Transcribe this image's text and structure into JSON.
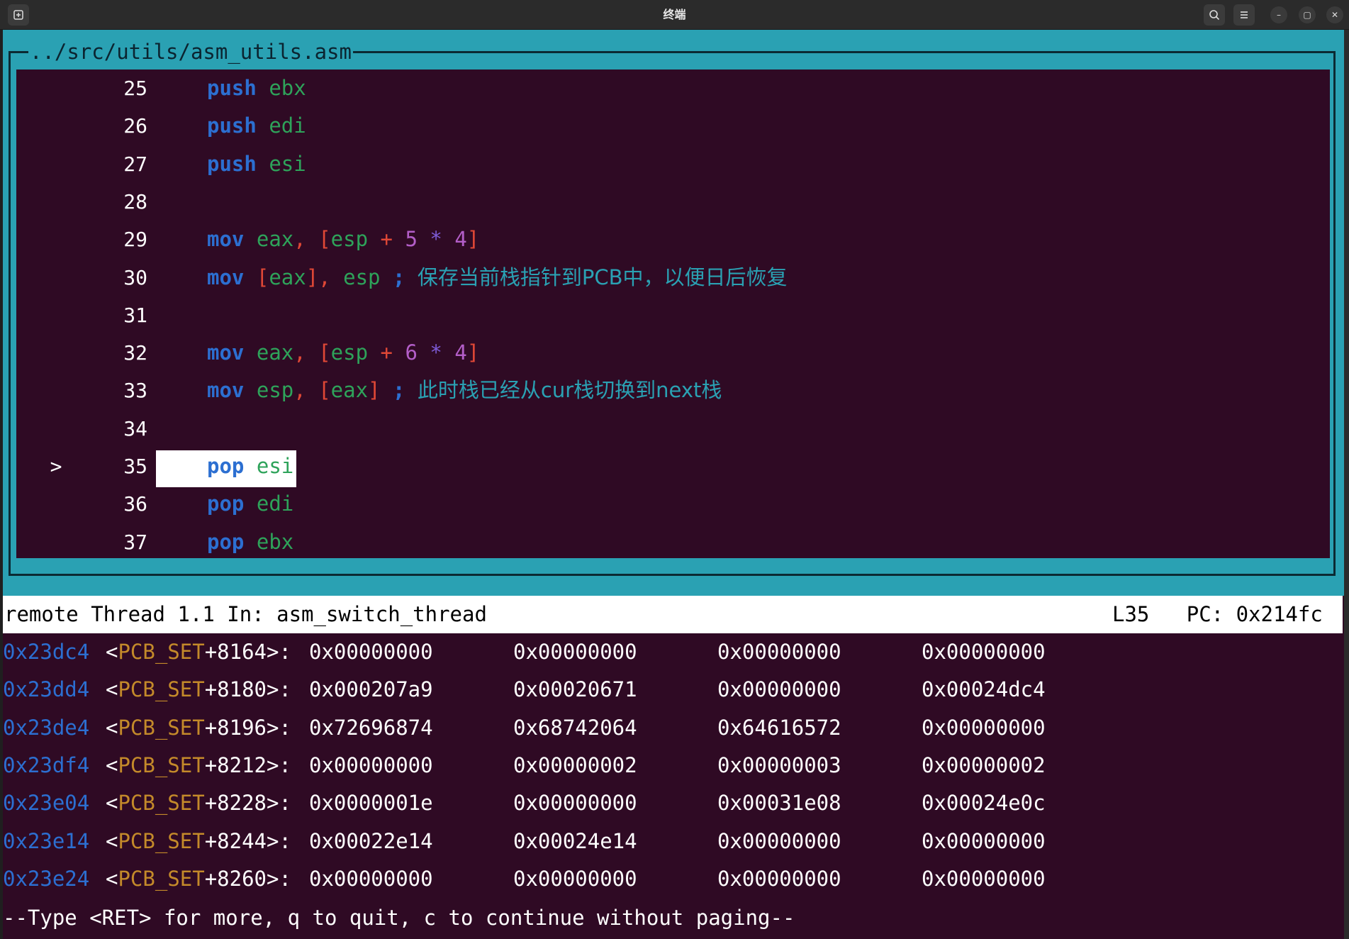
{
  "window": {
    "title": "终端",
    "left_icon": "new-tab-icon",
    "search_icon": "search-icon",
    "menu_icon": "hamburger-menu-icon",
    "minimize_glyph": "–",
    "maximize_glyph": "▢",
    "close_glyph": "✕",
    "colors": {
      "titlebar": "#2b2b2b",
      "terminal_bg": "#2f0a24",
      "tui_border": "#2aa1b3"
    }
  },
  "source": {
    "file_title": "../src/utils/asm_utils.asm",
    "current_marker": ">",
    "lines": [
      {
        "num": "25",
        "tokens": [
          {
            "t": "push",
            "c": "kw"
          },
          {
            "t": " "
          },
          {
            "t": "ebx",
            "c": "reg"
          }
        ]
      },
      {
        "num": "26",
        "tokens": [
          {
            "t": "push",
            "c": "kw"
          },
          {
            "t": " "
          },
          {
            "t": "edi",
            "c": "reg"
          }
        ]
      },
      {
        "num": "27",
        "tokens": [
          {
            "t": "push",
            "c": "kw"
          },
          {
            "t": " "
          },
          {
            "t": "esi",
            "c": "reg"
          }
        ]
      },
      {
        "num": "28",
        "tokens": []
      },
      {
        "num": "29",
        "tokens": [
          {
            "t": "mov",
            "c": "kw"
          },
          {
            "t": " "
          },
          {
            "t": "eax",
            "c": "reg"
          },
          {
            "t": ",",
            "c": "br"
          },
          {
            "t": " "
          },
          {
            "t": "[",
            "c": "br"
          },
          {
            "t": "esp",
            "c": "reg"
          },
          {
            "t": " "
          },
          {
            "t": "+",
            "c": "br"
          },
          {
            "t": " "
          },
          {
            "t": "5",
            "c": "num"
          },
          {
            "t": " "
          },
          {
            "t": "*",
            "c": "pl"
          },
          {
            "t": " "
          },
          {
            "t": "4",
            "c": "num"
          },
          {
            "t": "]",
            "c": "br"
          }
        ]
      },
      {
        "num": "30",
        "tokens": [
          {
            "t": "mov",
            "c": "kw"
          },
          {
            "t": " "
          },
          {
            "t": "[",
            "c": "br"
          },
          {
            "t": "eax",
            "c": "reg"
          },
          {
            "t": "],",
            "c": "br"
          },
          {
            "t": " "
          },
          {
            "t": "esp",
            "c": "reg"
          },
          {
            "t": " "
          },
          {
            "t": ";",
            "c": "kw"
          },
          {
            "t": " "
          },
          {
            "t": "保存当前栈指针到PCB中，以便日后恢复",
            "c": "cm"
          }
        ]
      },
      {
        "num": "31",
        "tokens": []
      },
      {
        "num": "32",
        "tokens": [
          {
            "t": "mov",
            "c": "kw"
          },
          {
            "t": " "
          },
          {
            "t": "eax",
            "c": "reg"
          },
          {
            "t": ",",
            "c": "br"
          },
          {
            "t": " "
          },
          {
            "t": "[",
            "c": "br"
          },
          {
            "t": "esp",
            "c": "reg"
          },
          {
            "t": " "
          },
          {
            "t": "+",
            "c": "br"
          },
          {
            "t": " "
          },
          {
            "t": "6",
            "c": "num"
          },
          {
            "t": " "
          },
          {
            "t": "*",
            "c": "pl"
          },
          {
            "t": " "
          },
          {
            "t": "4",
            "c": "num"
          },
          {
            "t": "]",
            "c": "br"
          }
        ]
      },
      {
        "num": "33",
        "tokens": [
          {
            "t": "mov",
            "c": "kw"
          },
          {
            "t": " "
          },
          {
            "t": "esp",
            "c": "reg"
          },
          {
            "t": ",",
            "c": "br"
          },
          {
            "t": " "
          },
          {
            "t": "[",
            "c": "br"
          },
          {
            "t": "eax",
            "c": "reg"
          },
          {
            "t": "]",
            "c": "br"
          },
          {
            "t": " "
          },
          {
            "t": ";",
            "c": "kw"
          },
          {
            "t": " "
          },
          {
            "t": "此时栈已经从cur栈切换到next栈",
            "c": "cm"
          }
        ]
      },
      {
        "num": "34",
        "tokens": []
      },
      {
        "num": "35",
        "current": true,
        "tokens": [
          {
            "t": "pop",
            "c": "kw"
          },
          {
            "t": " "
          },
          {
            "t": "esi",
            "c": "reg"
          }
        ]
      },
      {
        "num": "36",
        "tokens": [
          {
            "t": "pop",
            "c": "kw"
          },
          {
            "t": " "
          },
          {
            "t": "edi",
            "c": "reg"
          }
        ]
      },
      {
        "num": "37",
        "tokens": [
          {
            "t": "pop",
            "c": "kw"
          },
          {
            "t": " "
          },
          {
            "t": "ebx",
            "c": "reg"
          }
        ]
      }
    ]
  },
  "status": {
    "left": "remote Thread 1.1 In: asm_switch_thread",
    "right": "L35   PC: 0x214fc"
  },
  "memory": [
    {
      "addr": "0x23dc4",
      "sym": "PCB_SET",
      "off": "+8164",
      "vals": [
        "0x00000000",
        "0x00000000",
        "0x00000000",
        "0x00000000"
      ]
    },
    {
      "addr": "0x23dd4",
      "sym": "PCB_SET",
      "off": "+8180",
      "vals": [
        "0x000207a9",
        "0x00020671",
        "0x00000000",
        "0x00024dc4"
      ]
    },
    {
      "addr": "0x23de4",
      "sym": "PCB_SET",
      "off": "+8196",
      "vals": [
        "0x72696874",
        "0x68742064",
        "0x64616572",
        "0x00000000"
      ]
    },
    {
      "addr": "0x23df4",
      "sym": "PCB_SET",
      "off": "+8212",
      "vals": [
        "0x00000000",
        "0x00000002",
        "0x00000003",
        "0x00000002"
      ]
    },
    {
      "addr": "0x23e04",
      "sym": "PCB_SET",
      "off": "+8228",
      "vals": [
        "0x0000001e",
        "0x00000000",
        "0x00031e08",
        "0x00024e0c"
      ]
    },
    {
      "addr": "0x23e14",
      "sym": "PCB_SET",
      "off": "+8244",
      "vals": [
        "0x00022e14",
        "0x00024e14",
        "0x00000000",
        "0x00000000"
      ]
    },
    {
      "addr": "0x23e24",
      "sym": "PCB_SET",
      "off": "+8260",
      "vals": [
        "0x00000000",
        "0x00000000",
        "0x00000000",
        "0x00000000"
      ]
    }
  ],
  "pager": "--Type <RET> for more, q to quit, c to continue without paging--"
}
